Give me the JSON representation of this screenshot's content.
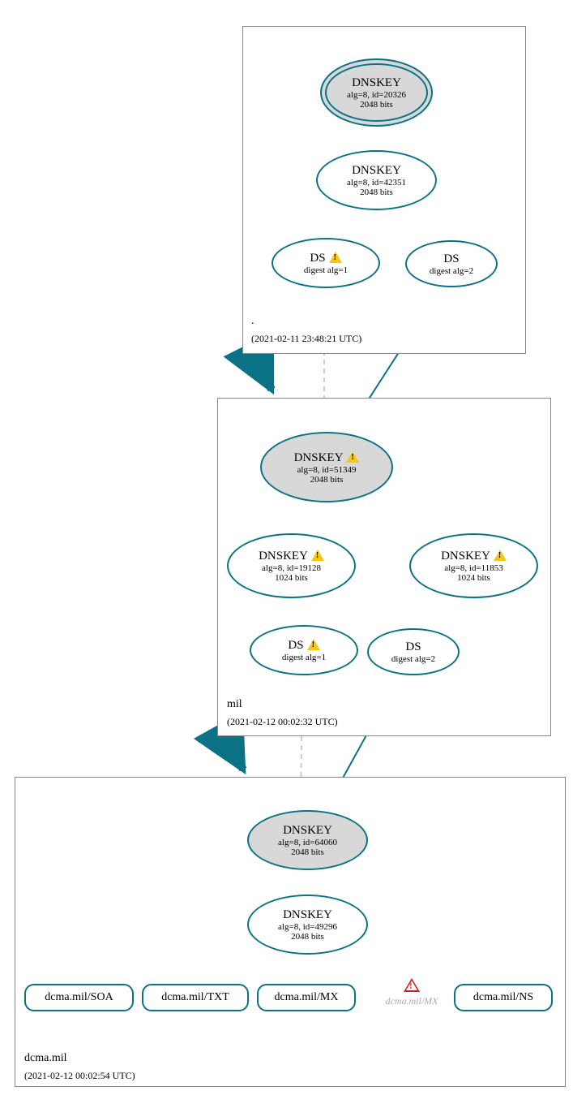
{
  "zones": {
    "root": {
      "name": ".",
      "timestamp": "(2021-02-11 23:48:21 UTC)"
    },
    "mil": {
      "name": "mil",
      "timestamp": "(2021-02-12 00:02:32 UTC)"
    },
    "dcma": {
      "name": "dcma.mil",
      "timestamp": "(2021-02-12 00:02:54 UTC)"
    }
  },
  "nodes": {
    "root_ksk": {
      "title": "DNSKEY",
      "l1": "alg=8, id=20326",
      "l2": "2048 bits"
    },
    "root_zsk": {
      "title": "DNSKEY",
      "l1": "alg=8, id=42351",
      "l2": "2048 bits"
    },
    "root_ds1": {
      "title": "DS",
      "l1": "digest alg=1"
    },
    "root_ds2": {
      "title": "DS",
      "l1": "digest alg=2"
    },
    "mil_ksk": {
      "title": "DNSKEY",
      "l1": "alg=8, id=51349",
      "l2": "2048 bits"
    },
    "mil_zsk1": {
      "title": "DNSKEY",
      "l1": "alg=8, id=19128",
      "l2": "1024 bits"
    },
    "mil_zsk2": {
      "title": "DNSKEY",
      "l1": "alg=8, id=11853",
      "l2": "1024 bits"
    },
    "mil_ds1": {
      "title": "DS",
      "l1": "digest alg=1"
    },
    "mil_ds2": {
      "title": "DS",
      "l1": "digest alg=2"
    },
    "dcma_ksk": {
      "title": "DNSKEY",
      "l1": "alg=8, id=64060",
      "l2": "2048 bits"
    },
    "dcma_zsk": {
      "title": "DNSKEY",
      "l1": "alg=8, id=49296",
      "l2": "2048 bits"
    },
    "rr_soa": "dcma.mil/SOA",
    "rr_txt": "dcma.mil/TXT",
    "rr_mx": "dcma.mil/MX",
    "rr_mx_err": "dcma.mil/MX",
    "rr_ns": "dcma.mil/NS"
  },
  "colors": {
    "stroke": "#0b7285"
  }
}
